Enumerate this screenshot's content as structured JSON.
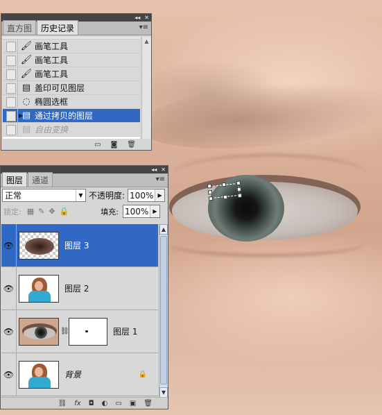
{
  "history_panel": {
    "tabs": [
      {
        "label": "直方图",
        "active": false
      },
      {
        "label": "历史记录",
        "active": true
      }
    ],
    "items": [
      {
        "label": "画笔工具",
        "icon": "brush-icon",
        "state": "normal"
      },
      {
        "label": "画笔工具",
        "icon": "brush-icon",
        "state": "normal"
      },
      {
        "label": "画笔工具",
        "icon": "brush-icon",
        "state": "normal"
      },
      {
        "label": "盖印可见图层",
        "icon": "document-icon",
        "state": "normal"
      },
      {
        "label": "椭圆选框",
        "icon": "elliptical-marquee-icon",
        "state": "normal"
      },
      {
        "label": "通过拷贝的图层",
        "icon": "document-icon",
        "state": "selected"
      },
      {
        "label": "自由变换",
        "icon": "document-icon",
        "state": "undone"
      }
    ]
  },
  "layers_panel": {
    "tabs": [
      {
        "label": "图层",
        "active": true
      },
      {
        "label": "通道",
        "active": false
      }
    ],
    "blend_mode": "正常",
    "opacity_label": "不透明度:",
    "opacity_value": "100%",
    "lock_label": "锁定:",
    "fill_label": "填充:",
    "fill_value": "100%",
    "layers": [
      {
        "name": "图层 3",
        "selected": true,
        "thumb": "eye-copy"
      },
      {
        "name": "图层 2",
        "selected": false,
        "thumb": "woman"
      },
      {
        "name": "图层 1",
        "selected": false,
        "thumb": "eye",
        "mask": true
      },
      {
        "name": "背景",
        "selected": false,
        "thumb": "woman",
        "locked": true
      }
    ]
  },
  "colors": {
    "selection_blue": "#3168c4",
    "panel_gray": "#d6d6d6"
  }
}
